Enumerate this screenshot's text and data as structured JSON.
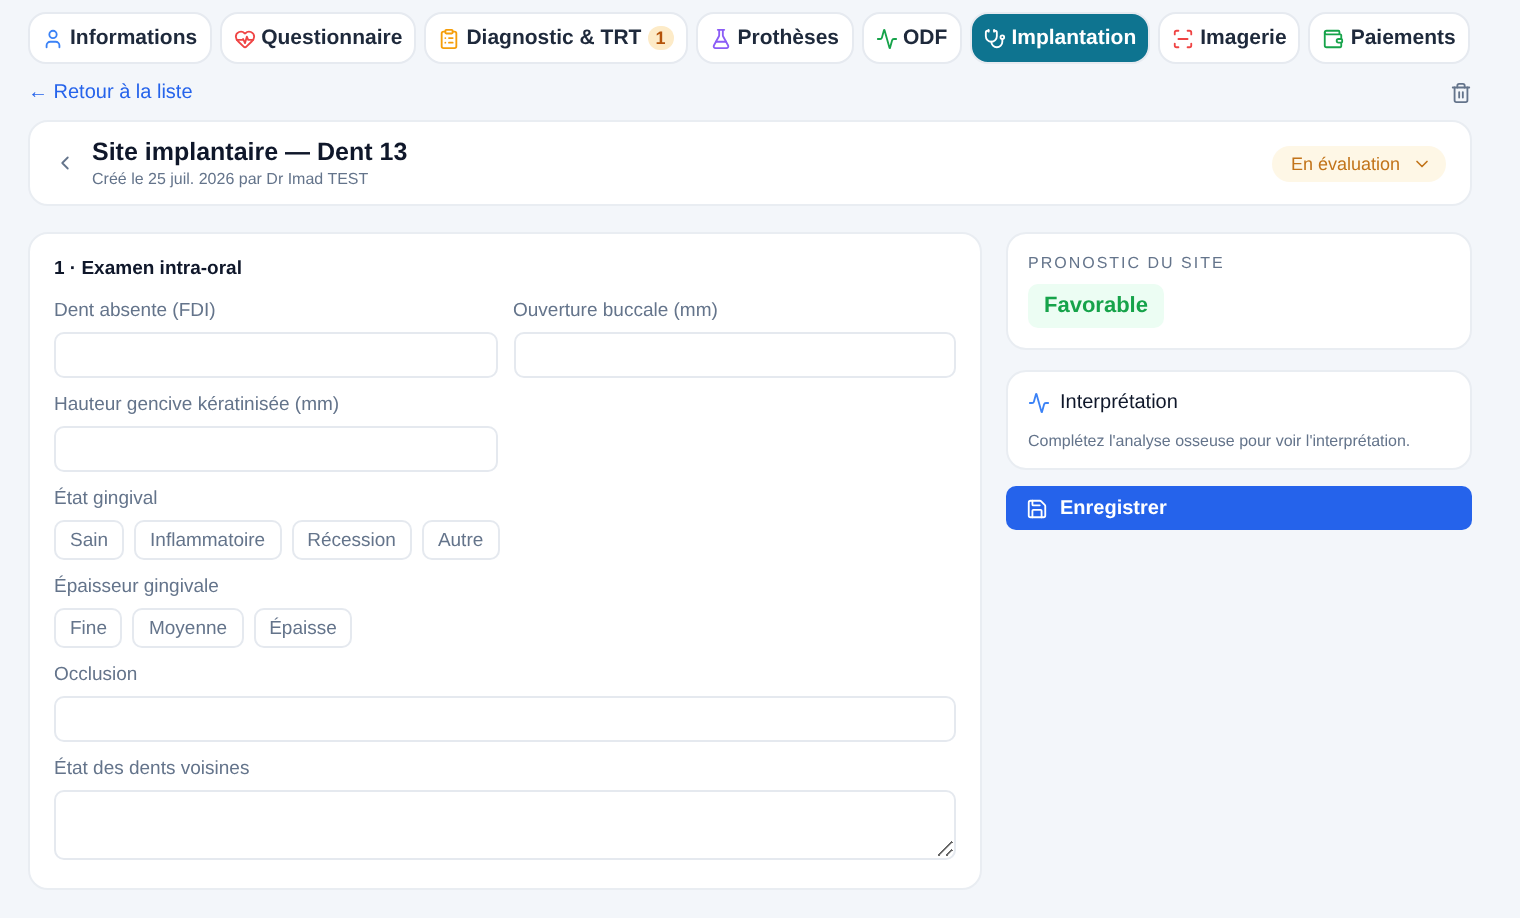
{
  "tabs": [
    {
      "label": "Informations",
      "selected": false
    },
    {
      "label": "Questionnaire",
      "selected": false
    },
    {
      "label": "Diagnostic & TRT",
      "selected": false,
      "badge": "1"
    },
    {
      "label": "Prothèses",
      "selected": false
    },
    {
      "label": "ODF",
      "selected": false
    },
    {
      "label": "Implantation",
      "selected": true
    },
    {
      "label": "Imagerie",
      "selected": false
    },
    {
      "label": "Paiements",
      "selected": false
    }
  ],
  "back_link": "← Retour à la liste",
  "header": {
    "title": "Site implantaire — Dent 13",
    "subtitle": "Créé le 25 juil. 2026 par Dr Imad TEST",
    "status": "En évaluation"
  },
  "section": {
    "title": "1 · Examen intra-oral",
    "rows": [
      {
        "kind": "fields",
        "fields": [
          {
            "label": "Dent absente (FDI)"
          },
          {
            "label": "Ouverture buccale (mm)"
          }
        ]
      },
      {
        "kind": "fields",
        "fields": [
          {
            "label": "Hauteur gencive kératinisée (mm)"
          }
        ]
      },
      {
        "kind": "chips",
        "label": "État gingival",
        "options": [
          {
            "label": "Sain",
            "selected": false
          },
          {
            "label": "Inflammatoire",
            "selected": false
          },
          {
            "label": "Récession",
            "selected": false
          },
          {
            "label": "Autre",
            "selected": false
          }
        ]
      },
      {
        "kind": "chips",
        "label": "Épaisseur gingivale",
        "options": [
          {
            "label": "Fine",
            "selected": false
          },
          {
            "label": "Moyenne",
            "selected": false
          },
          {
            "label": "Épaisse",
            "selected": false
          }
        ]
      },
      {
        "kind": "wide",
        "label": "Occlusion"
      },
      {
        "kind": "textarea",
        "label": "État des dents voisines"
      }
    ]
  },
  "prognosis": {
    "title": "PRONOSTIC DU SITE",
    "value": "Favorable"
  },
  "interpretation": {
    "title": "Interprétation",
    "text": "Complétez l'analyse osseuse pour voir l'interprétation."
  },
  "save_button": "Enregistrer"
}
